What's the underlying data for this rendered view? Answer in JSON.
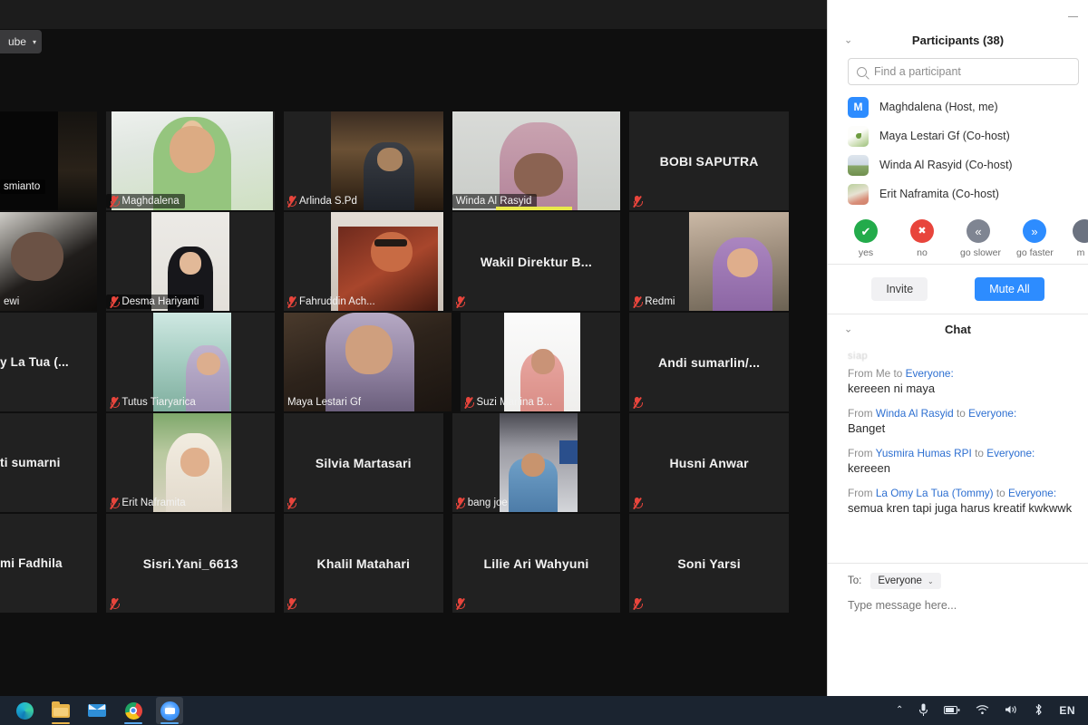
{
  "window": {
    "minimize_label": "minimize",
    "overlay_button_label": "ube",
    "overlay_button_caret": "▾"
  },
  "participants_panel": {
    "title": "Participants (38)",
    "collapse_icon": "chevron-down-icon",
    "search_placeholder": "Find a participant",
    "search_value": "",
    "items": [
      {
        "name": "Maghdalena (Host, me)",
        "avatar_type": "letter",
        "avatar_letter": "M"
      },
      {
        "name": "Maya Lestari Gf (Co-host)",
        "avatar_type": "img1",
        "avatar_letter": ""
      },
      {
        "name": "Winda Al Rasyid (Co-host)",
        "avatar_type": "img2",
        "avatar_letter": ""
      },
      {
        "name": "Erit Naframita (Co-host)",
        "avatar_type": "img3",
        "avatar_letter": ""
      }
    ],
    "reactions": [
      {
        "label": "yes",
        "glyph": "✔",
        "color": "#23ab4b"
      },
      {
        "label": "no",
        "glyph": "✖",
        "color": "#e8453c"
      },
      {
        "label": "go slower",
        "glyph": "«",
        "color": "#7f8592"
      },
      {
        "label": "go faster",
        "glyph": "»",
        "color": "#2d8cff"
      },
      {
        "label": "m",
        "glyph": "•",
        "color": "#6b7280"
      }
    ],
    "invite_label": "Invite",
    "mute_all_label": "Mute All"
  },
  "chat_panel": {
    "title": "Chat",
    "collapse_icon": "chevron-down-icon",
    "scrolled_message": "siap",
    "messages": [
      {
        "from_prefix": "From",
        "sender": "Me",
        "to_word": "to",
        "recipient": "Everyone:",
        "text": "kereeen ni maya",
        "sender_is_link": false
      },
      {
        "from_prefix": "From",
        "sender": "Winda Al Rasyid",
        "to_word": "to",
        "recipient": "Everyone:",
        "text": "Banget",
        "sender_is_link": true
      },
      {
        "from_prefix": "From",
        "sender": "Yusmira Humas RPI",
        "to_word": "to",
        "recipient": "Everyone:",
        "text": "kereeen",
        "sender_is_link": true
      },
      {
        "from_prefix": "From",
        "sender": "La Omy La Tua (Tommy)",
        "to_word": "to",
        "recipient": "Everyone:",
        "text": "semua kren tapi juga harus kreatif kwkwwk",
        "sender_is_link": true
      }
    ],
    "to_label": "To:",
    "to_value": "Everyone",
    "to_caret": "⌄",
    "input_placeholder": "Type message here...",
    "input_value": ""
  },
  "video_grid": {
    "rows": [
      [
        {
          "name": "smianto",
          "display": "label",
          "muted": false,
          "video": "dark",
          "clipped": true
        },
        {
          "name": "Maghdalena",
          "display": "label",
          "muted": true,
          "video": "maghdalena"
        },
        {
          "name": "Arlinda S.Pd",
          "display": "label",
          "muted": true,
          "video": "arlinda"
        },
        {
          "name": "Winda Al Rasyid",
          "display": "label",
          "muted": false,
          "video": "winda",
          "speaking": true
        },
        {
          "name": "BOBI SAPUTRA",
          "display": "center",
          "muted": true,
          "video": "none"
        }
      ],
      [
        {
          "name": "ewi",
          "display": "label",
          "muted": false,
          "video": "dewi",
          "clipped": true
        },
        {
          "name": "Desma Hariyanti",
          "display": "label",
          "muted": true,
          "video": "desma"
        },
        {
          "name": "Fahruddin Ach...",
          "display": "label",
          "muted": true,
          "video": "fahruddin"
        },
        {
          "name": "Wakil  Direktur  B...",
          "display": "center",
          "muted": true,
          "video": "none"
        },
        {
          "name": "Redmi",
          "display": "label",
          "muted": true,
          "video": "redmi"
        }
      ],
      [
        {
          "name": "y La Tua (...",
          "display": "center-left",
          "muted": false,
          "video": "none",
          "clipped": true
        },
        {
          "name": "Tutus Tiaryarica",
          "display": "label",
          "muted": true,
          "video": "tutus"
        },
        {
          "name": "Maya Lestari Gf",
          "display": "label",
          "muted": false,
          "video": "maya",
          "active_speaker": true
        },
        {
          "name": "Suzi Marlina B...",
          "display": "label",
          "muted": true,
          "video": "suzi"
        },
        {
          "name": "Andi  sumarlin/...",
          "display": "center",
          "muted": true,
          "video": "none"
        }
      ],
      [
        {
          "name": "ti sumarni",
          "display": "center-left",
          "muted": false,
          "video": "none",
          "clipped": true
        },
        {
          "name": "Erit Naframita",
          "display": "label",
          "muted": true,
          "video": "erit"
        },
        {
          "name": "Silvia Martasari",
          "display": "center",
          "muted": true,
          "video": "none"
        },
        {
          "name": "bang joe",
          "display": "label",
          "muted": true,
          "video": "bangjoe"
        },
        {
          "name": "Husni Anwar",
          "display": "center",
          "muted": true,
          "video": "none"
        }
      ],
      [
        {
          "name": "mi Fadhila",
          "display": "center-left",
          "muted": false,
          "video": "none",
          "clipped": true
        },
        {
          "name": "Sisri.Yani_6613",
          "display": "center",
          "muted": true,
          "video": "none"
        },
        {
          "name": "Khalil Matahari",
          "display": "center",
          "muted": true,
          "video": "none"
        },
        {
          "name": "Lilie Ari Wahyuni",
          "display": "center",
          "muted": true,
          "video": "none"
        },
        {
          "name": "Soni Yarsi",
          "display": "center",
          "muted": true,
          "video": "none"
        }
      ]
    ]
  },
  "taskbar": {
    "apps": [
      {
        "icon": "edge-icon",
        "active": false
      },
      {
        "icon": "file-explorer-icon",
        "active": false
      },
      {
        "icon": "mail-icon",
        "active": false
      },
      {
        "icon": "chrome-icon",
        "active": false
      },
      {
        "icon": "zoom-icon",
        "active": true
      }
    ],
    "tray": {
      "chevron": "⌃",
      "microphone": "🎙",
      "battery": "battery-icon",
      "wifi": "wifi-icon",
      "volume": "volume-icon",
      "bluetooth": "bluetooth-icon",
      "language": "EN"
    }
  },
  "colors": {
    "accent_blue": "#2d8cff",
    "active_speaker": "#c8e84a",
    "mute_red": "#e8453c",
    "panel_bg": "#ffffff",
    "stage_bg": "#0f0f0f",
    "taskbar_bg": "#1b2430"
  }
}
